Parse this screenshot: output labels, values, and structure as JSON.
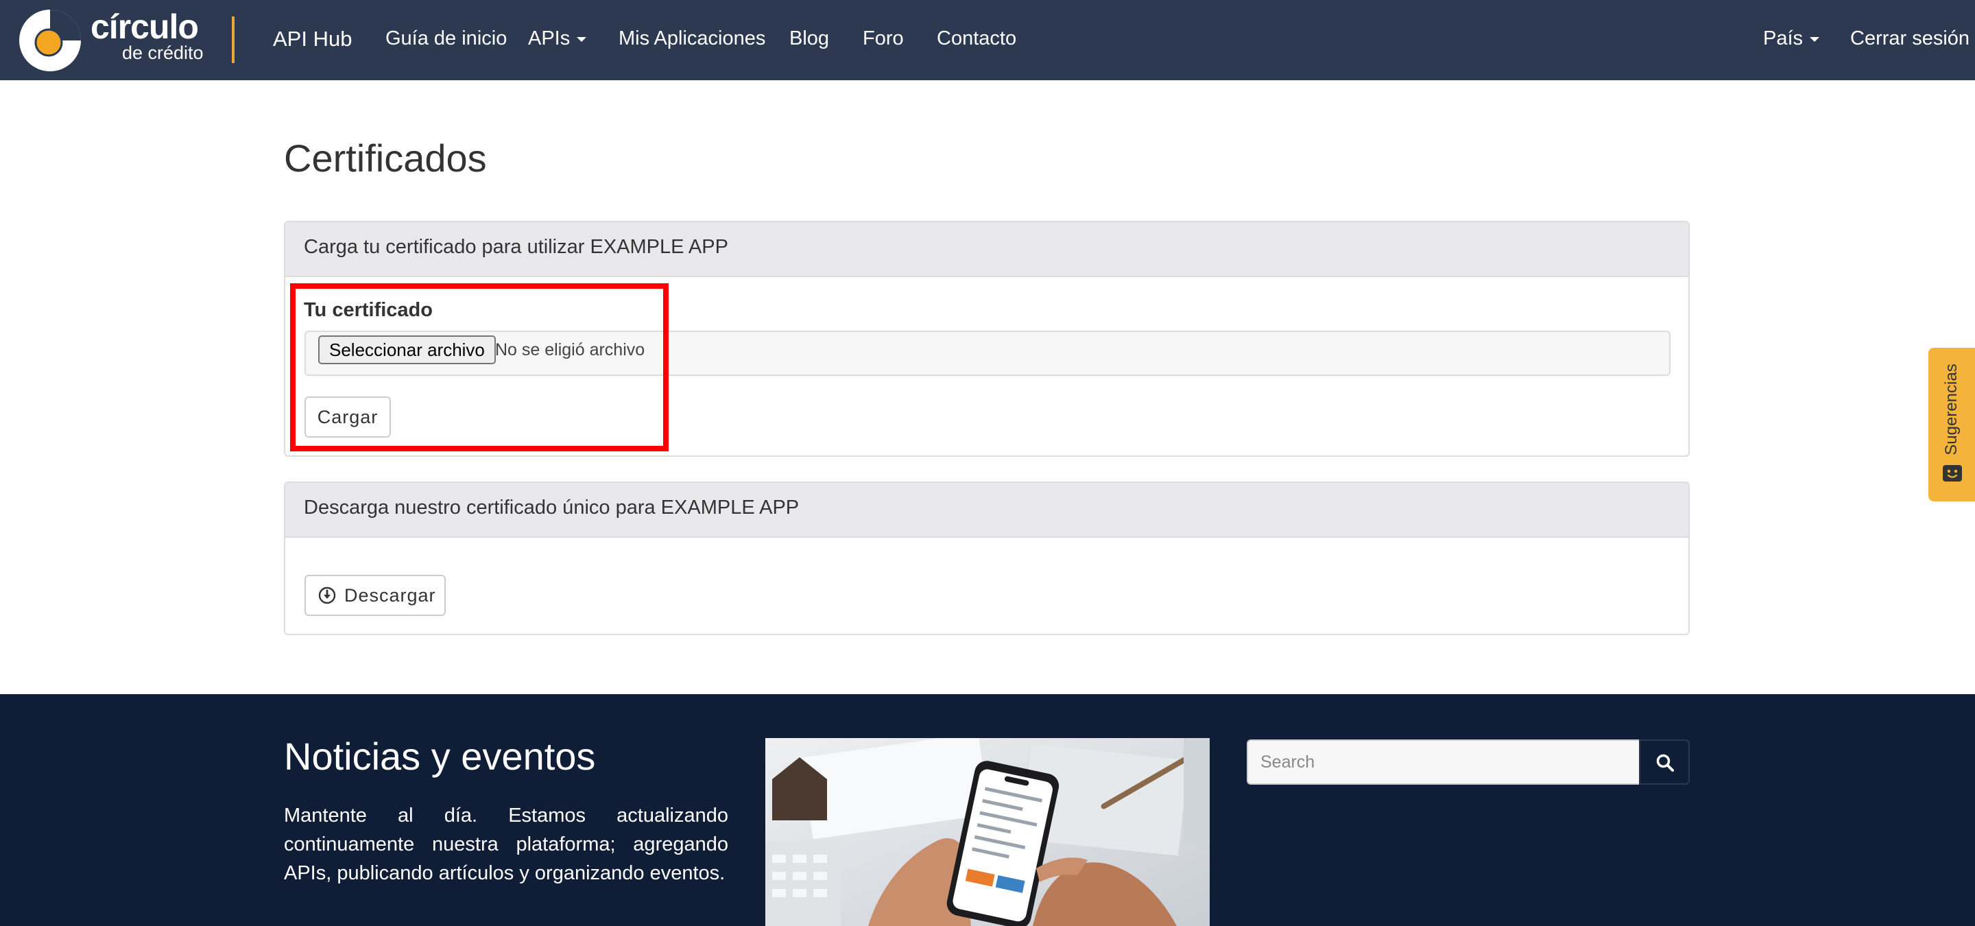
{
  "navbar": {
    "brand_name": "círculo",
    "brand_sub": "de crédito",
    "api_hub": "API Hub",
    "links": {
      "guia": "Guía de inicio",
      "apis": "APIs",
      "mis_apps": "Mis Aplicaciones",
      "blog": "Blog",
      "foro": "Foro",
      "contacto": "Contacto"
    },
    "pais": "País",
    "cerrar_sesion": "Cerrar sesión"
  },
  "page": {
    "title": "Certificados"
  },
  "upload_panel": {
    "heading": "Carga tu certificado para utilizar EXAMPLE APP",
    "field_label": "Tu certificado",
    "file_button": "Seleccionar archivo",
    "file_status": "No se eligió archivo",
    "submit_label": "Cargar"
  },
  "download_panel": {
    "heading": "Descarga nuestro certificado único para EXAMPLE APP",
    "button_label": "Descargar"
  },
  "feedback_tab": {
    "label": "Sugerencias"
  },
  "footer": {
    "title": "Noticias y eventos",
    "text": "Mantente al día. Estamos actualizando continuamente nuestra plataforma; agregando APIs, publicando artículos y organizando eventos.",
    "search_placeholder": "Search"
  },
  "colors": {
    "navbar_bg": "#2c3950",
    "footer_bg": "#0f1d36",
    "accent_orange": "#e8a838",
    "feedback_tab": "#f4b33a",
    "highlight_red": "#ff0000"
  },
  "icons": {
    "brand": "circulo-logo-icon",
    "download": "download-circle-icon",
    "feedback": "chat-face-icon",
    "search": "search-icon"
  }
}
